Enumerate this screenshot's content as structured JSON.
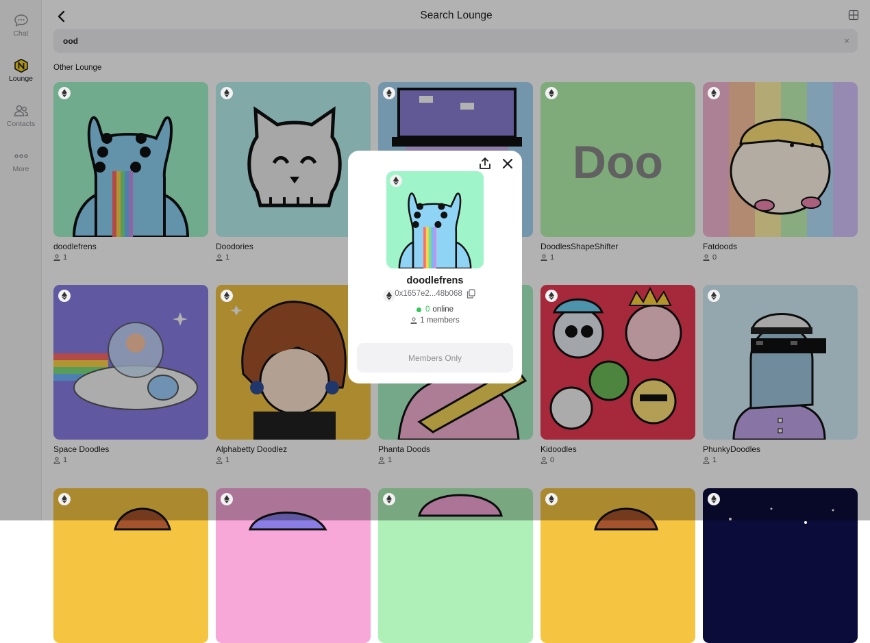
{
  "sidebar": {
    "items": [
      {
        "label": "Chat",
        "icon": "chat-bubble-icon"
      },
      {
        "label": "Lounge",
        "icon": "lounge-n-icon",
        "active": true
      },
      {
        "label": "Contacts",
        "icon": "contacts-icon"
      },
      {
        "label": "More",
        "icon": "more-dots-icon"
      }
    ]
  },
  "header": {
    "title": "Search Lounge",
    "back_icon": "chevron-left-icon",
    "layout_icon": "grid-layout-icon"
  },
  "search": {
    "value": "ood",
    "clear_label": "×"
  },
  "section": {
    "label": "Other Lounge"
  },
  "lounges": [
    {
      "name": "doodlefrens",
      "members": "1"
    },
    {
      "name": "Doodories",
      "members": "1"
    },
    {
      "name": "",
      "members": ""
    },
    {
      "name": "DoodlesShapeShifter",
      "members": "1"
    },
    {
      "name": "Fatdoods",
      "members": "0"
    },
    {
      "name": "Space Doodles",
      "members": "1"
    },
    {
      "name": "Alphabetty Doodlez",
      "members": "1"
    },
    {
      "name": "Phanta Doods",
      "members": "1"
    },
    {
      "name": "Kidoodles",
      "members": "0"
    },
    {
      "name": "PhunkyDoodles",
      "members": "1"
    }
  ],
  "shapeshifter_art_text": "Doo",
  "modal": {
    "name": "doodlefrens",
    "address": "0x1657e2...48b068",
    "online_count": "0",
    "online_label": "online",
    "members_text": "1 members",
    "button_label": "Members Only",
    "share_icon": "share-icon",
    "close_icon": "close-icon",
    "copy_icon": "copy-icon"
  },
  "colors": {
    "accent_green": "#34c759",
    "lounge_icon_yellow": "#f5d31c"
  }
}
